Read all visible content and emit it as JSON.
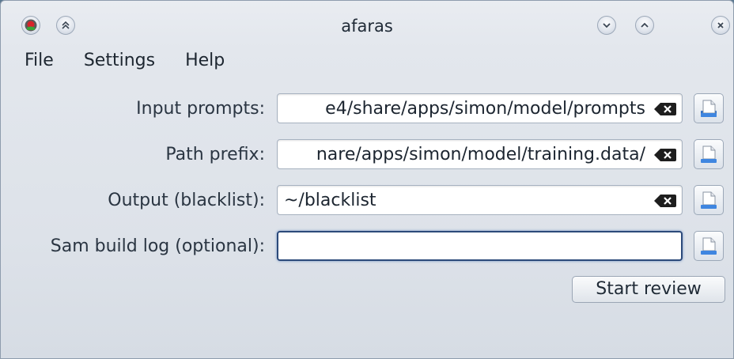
{
  "window": {
    "title": "afaras"
  },
  "menu": [
    "File",
    "Settings",
    "Help"
  ],
  "form": {
    "input_prompts": {
      "label": "Input prompts:",
      "value": "e4/share/apps/simon/model/prompts"
    },
    "path_prefix": {
      "label": "Path prefix:",
      "value": "nare/apps/simon/model/training.data/"
    },
    "output_blacklist": {
      "label": "Output (blacklist):",
      "value": "~/blacklist"
    },
    "sam_build_log": {
      "label": "Sam build log (optional):",
      "value": ""
    }
  },
  "actions": {
    "start_review": "Start review"
  },
  "icons": {
    "app": "simon-app-icon",
    "shade": "shade-up-icon",
    "minimize": "minimize-icon",
    "maximize": "maximize-icon",
    "close": "close-icon",
    "clear": "clear-text-icon",
    "file": "open-file-icon"
  },
  "colors": {
    "focus_border": "#2c4a7a",
    "app_icon_red": "#d8232a",
    "app_icon_green": "#3aa53a"
  }
}
